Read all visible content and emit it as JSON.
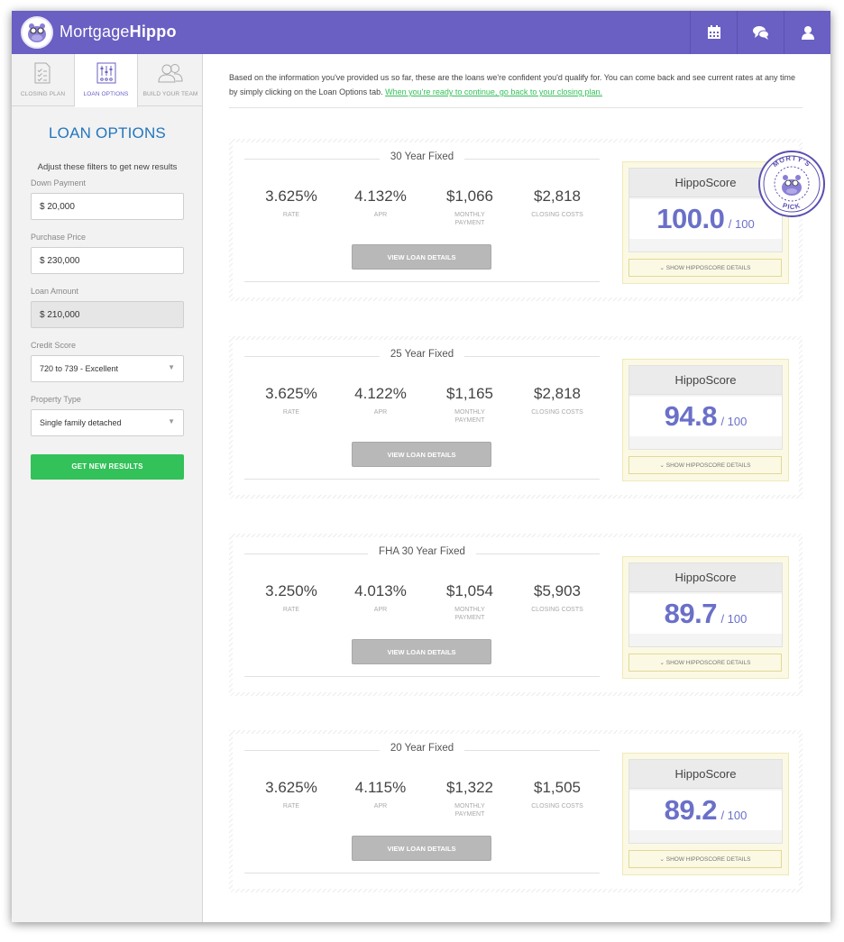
{
  "app": {
    "brand_light": "Mortgage",
    "brand_bold": "Hippo",
    "accent_color": "#6a5fc3",
    "header_icons": [
      "calendar-icon",
      "chat-icon",
      "user-icon"
    ]
  },
  "sidebar": {
    "tabs": [
      {
        "label": "CLOSING PLAN",
        "icon": "checklist-icon"
      },
      {
        "label": "LOAN OPTIONS",
        "icon": "sliders-icon",
        "active": true
      },
      {
        "label": "BUILD YOUR TEAM",
        "icon": "team-icon"
      }
    ],
    "title": "LOAN OPTIONS",
    "subtitle": "Adjust these filters to get new results",
    "fields": {
      "down_payment": {
        "label": "Down Payment",
        "value": "$ 20,000"
      },
      "purchase_price": {
        "label": "Purchase Price",
        "value": "$ 230,000"
      },
      "loan_amount": {
        "label": "Loan Amount",
        "value": "$ 210,000"
      },
      "credit_score": {
        "label": "Credit Score",
        "value": "720 to 739 - Excellent"
      },
      "property_type": {
        "label": "Property Type",
        "value": "Single family detached"
      }
    },
    "submit_label": "GET NEW RESULTS"
  },
  "main": {
    "intro_text": "Based on the information you've provided us so far, these are the loans we're confident you'd qualify for. You can come back and see current rates at any time by simply clicking on the Loan Options tab. ",
    "intro_link": "When you're ready to continue, go back to your closing plan.",
    "labels": {
      "rate": "RATE",
      "apr": "APR",
      "monthly": "MONTHLY PAYMENT",
      "closing": "CLOSING COSTS",
      "view_details": "VIEW LOAN DETAILS",
      "hipposcore": "HippoScore",
      "score_max": "/ 100",
      "show_details": "SHOW HIPPOSCORE DETAILS"
    },
    "badge_text": "MORTY'S PICK",
    "loans": [
      {
        "title": "30 Year Fixed",
        "rate": "3.625%",
        "apr": "4.132%",
        "monthly": "$1,066",
        "closing": "$2,818",
        "score": "100.0"
      },
      {
        "title": "25 Year Fixed",
        "rate": "3.625%",
        "apr": "4.122%",
        "monthly": "$1,165",
        "closing": "$2,818",
        "score": "94.8"
      },
      {
        "title": "FHA 30 Year Fixed",
        "rate": "3.250%",
        "apr": "4.013%",
        "monthly": "$1,054",
        "closing": "$5,903",
        "score": "89.7"
      },
      {
        "title": "20 Year Fixed",
        "rate": "3.625%",
        "apr": "4.115%",
        "monthly": "$1,322",
        "closing": "$1,505",
        "score": "89.2"
      }
    ]
  }
}
